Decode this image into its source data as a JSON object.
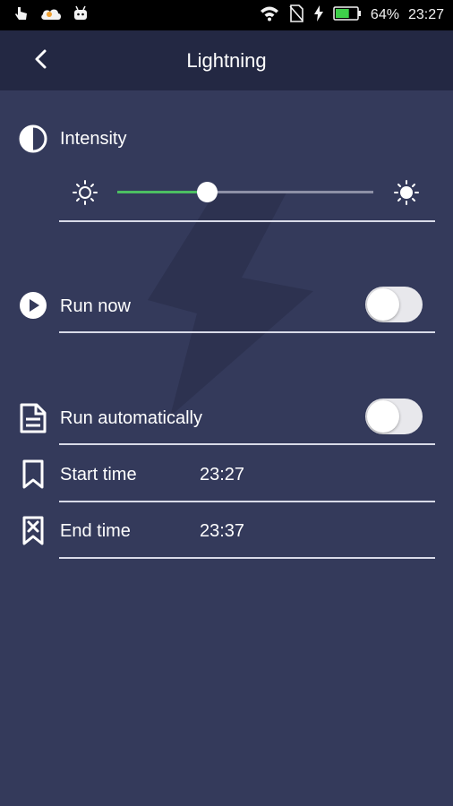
{
  "status_bar": {
    "battery_percent": "64%",
    "time": "23:27",
    "icons": [
      "hand-touch-icon",
      "cloud-icon",
      "android-icon",
      "wifi-icon",
      "no-sim-icon",
      "charging-icon",
      "battery-icon"
    ]
  },
  "app_bar": {
    "title": "Lightning",
    "back_icon": "chevron-left-icon"
  },
  "intensity": {
    "label": "Intensity",
    "icon": "contrast-icon",
    "level": 0.35,
    "min_icon": "sun-low-icon",
    "max_icon": "sun-high-icon"
  },
  "run_now": {
    "label": "Run now",
    "icon": "play-circle-icon",
    "enabled": false
  },
  "run_automatically": {
    "label": "Run automatically",
    "icon": "document-icon",
    "enabled": false
  },
  "start_time": {
    "label": "Start time",
    "value": "23:27",
    "icon": "bookmark-icon"
  },
  "end_time": {
    "label": "End time",
    "value": "23:37",
    "icon": "bookmark-x-icon"
  },
  "colors": {
    "background": "#343a5b",
    "app_bar": "#232843",
    "slider_fill": "#4cbf62"
  }
}
